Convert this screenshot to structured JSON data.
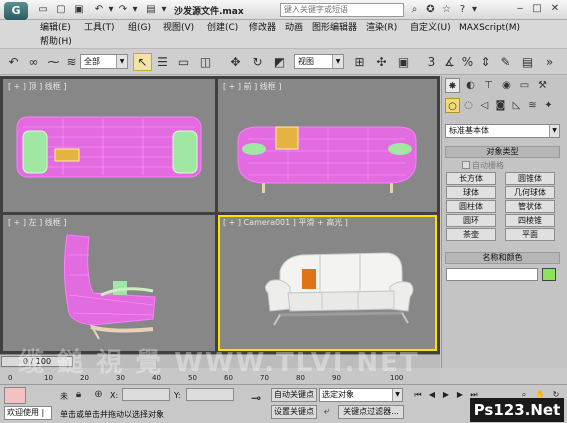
{
  "app": {
    "logo_glyph": "G",
    "document_title": "沙发源文件.max",
    "search_placeholder": "键入关键字或短语",
    "window_controls": [
      "‒",
      "□",
      "✕"
    ]
  },
  "menu": {
    "items": [
      "编辑(E)",
      "工具(T)",
      "组(G)",
      "视图(V)",
      "创建(C)",
      "修改器",
      "动画",
      "图形编辑器",
      "渲染(R)",
      "自定义(U)",
      "MAXScript(M)",
      "帮助(H)"
    ]
  },
  "toolbar": {
    "selection_filter": "全部",
    "reference_coord": "视图",
    "snap_label": "3"
  },
  "viewports": {
    "top": {
      "label": "[ + ] 顶 ] 线框 ]"
    },
    "front": {
      "label": "[ + ] 前 ] 线框 ]"
    },
    "left": {
      "label": "[ + ] 左 ] 线框 ]"
    },
    "camera": {
      "label": "[ + ] Camera001 ] 平滑 + 高光 ]"
    }
  },
  "command_panel": {
    "category": "标准基本体",
    "object_type_header": "对象类型",
    "autogrid_label": "自动栅格",
    "object_buttons": [
      "长方体",
      "圆锥体",
      "球体",
      "几何球体",
      "圆柱体",
      "管状体",
      "圆环",
      "四棱锥",
      "茶壶",
      "平面"
    ],
    "name_color_header": "名称和颜色",
    "object_color": "#8ee25a"
  },
  "timeline": {
    "slider_label": "0 / 100",
    "ticks": [
      "0",
      "10",
      "20",
      "30",
      "40",
      "50",
      "60",
      "70",
      "80",
      "90",
      "100"
    ]
  },
  "status": {
    "welcome": "欢迎使用 |",
    "selection_label": "未",
    "x_label": "X:",
    "y_label": "Y:",
    "hint": "单击或单击并拖动以选择对象",
    "auto_key": "自动关键点",
    "set_key": "设置关键点",
    "selected_object": "选定对象",
    "key_filters": "关键点过滤器...",
    "frame": "0"
  },
  "watermark": "缆 鎚 視 覺 WWW.TLVI.NET",
  "badge": "Ps123.Net"
}
